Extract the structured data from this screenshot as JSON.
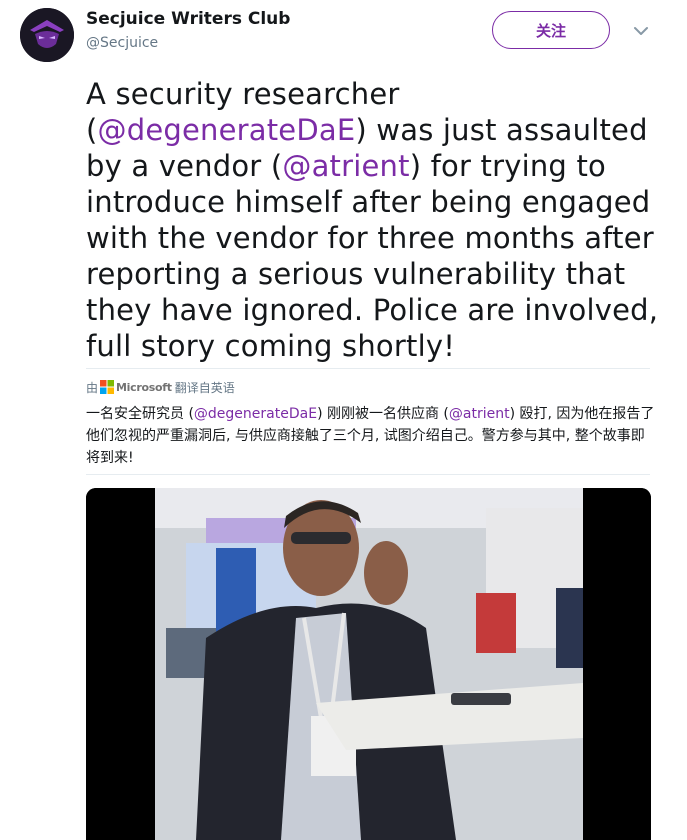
{
  "author": {
    "display_name": "Secjuice Writers Club",
    "handle": "@Secjuice",
    "avatar_icon": "hooded-figure-logo-icon"
  },
  "actions": {
    "follow_label": "关注",
    "menu_icon": "chevron-down-icon"
  },
  "tweet": {
    "segments": [
      {
        "text": "A security researcher (",
        "type": "text"
      },
      {
        "text": "@degenerateDaE",
        "type": "mention"
      },
      {
        "text": ") was just assaulted by a vendor (",
        "type": "text"
      },
      {
        "text": "@atrient",
        "type": "mention"
      },
      {
        "text": ") for trying to introduce himself after being engaged with the vendor for three months after reporting a serious vulnerability that they have ignored. Police are involved, full story coming shortly!",
        "type": "text"
      }
    ]
  },
  "translation": {
    "prefix": "由",
    "provider": "Microsoft",
    "suffix": "翻译自英语",
    "segments": [
      {
        "text": "一名安全研究员 (",
        "type": "text"
      },
      {
        "text": "@degenerateDaE",
        "type": "mention"
      },
      {
        "text": ") 刚刚被一名供应商 (",
        "type": "text"
      },
      {
        "text": "@atrient",
        "type": "mention"
      },
      {
        "text": ") 殴打, 因为他在报告了他们忽视的严重漏洞后, 与供应商接触了三个月, 试图介绍自己。警方参与其中, 整个故事即将到来!",
        "type": "text"
      }
    ]
  },
  "media": {
    "type": "video",
    "description_icon": "video-thumbnail"
  },
  "colors": {
    "accent": "#7b2ca6",
    "text": "#14171a",
    "secondary": "#657786"
  }
}
